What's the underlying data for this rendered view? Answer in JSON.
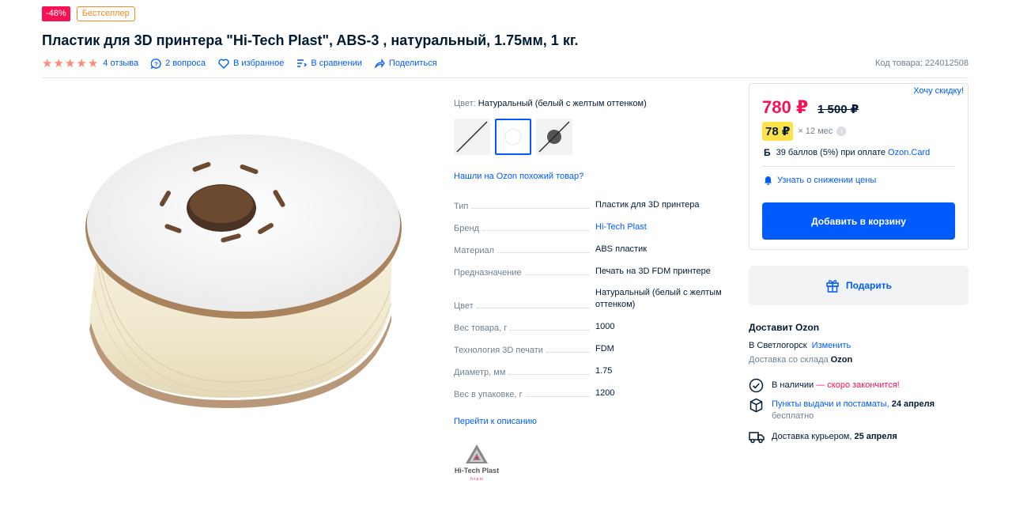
{
  "badges": {
    "sale": "-48%",
    "bestseller": "Бестселлер"
  },
  "product": {
    "title": "Пластик для 3D принтера \"Hi-Tech Plast\", ABS-3 , натуральный, 1.75мм, 1 кг.",
    "rating_stars": 5,
    "reviews": "4 отзыва",
    "questions": "2 вопроса",
    "favorite": "В избранное",
    "compare": "В сравнении",
    "share": "Поделиться",
    "sku": "Код товара: 224012508"
  },
  "variant": {
    "color_label": "Цвет:",
    "color_value": "Натуральный (белый с желтым оттенком)",
    "similar_link": "Нашли на Ozon похожий товар?"
  },
  "specs": [
    {
      "key": "Тип",
      "value": "Пластик для 3D принтера",
      "link": false
    },
    {
      "key": "Бренд",
      "value": "Hi-Tech Plast",
      "link": true
    },
    {
      "key": "Материал",
      "value": "ABS пластик",
      "link": false
    },
    {
      "key": "Предназначение",
      "value": "Печать на 3D FDM принтере",
      "link": false
    },
    {
      "key": "Цвет",
      "value": "Натуральный (белый с желтым оттенком)",
      "link": false
    },
    {
      "key": "Вес товара, г",
      "value": "1000",
      "link": false
    },
    {
      "key": "Технология 3D печати",
      "value": "FDM",
      "link": false
    },
    {
      "key": "Диаметр, мм",
      "value": "1.75",
      "link": false
    },
    {
      "key": "Вес в упаковке, г",
      "value": "1200",
      "link": false
    }
  ],
  "goto_description": "Перейти к описанию",
  "brand_logo": {
    "name": "Hi-Tech Plast",
    "site": "h-t-p.ru"
  },
  "price_card": {
    "want_discount": "Хочу скидку!",
    "price": "780 ₽",
    "old_price": "1 500 ₽",
    "installment_amount": "78 ₽",
    "installment_term": "× 12 мес",
    "bonus_icon": "Б",
    "bonus_text": "39 баллов (5%) при оплате",
    "bonus_link": "Ozon.Card",
    "notify_price": "Узнать о снижении цены",
    "add_to_cart": "Добавить в корзину"
  },
  "gift_button": "Подарить",
  "delivery": {
    "title": "Доставит Ozon",
    "city": "В Светлогорск",
    "change": "Изменить",
    "warehouse_prefix": "Доставка со склада",
    "warehouse_name": "Ozon",
    "in_stock": "В наличии",
    "in_stock_warning": "— скоро закончится!",
    "pickup_link": "Пункты выдачи и постаматы,",
    "pickup_date": "24 апреля",
    "pickup_price": "бесплатно",
    "courier": "Доставка курьером,",
    "courier_date": "25 апреля"
  },
  "colors": {
    "accent": "#005bff",
    "sale": "#f91155",
    "bestseller": "#f08a24",
    "star": "#fc8a75",
    "installment": "#ffe249"
  },
  "icons": [
    "star-icon",
    "question-icon",
    "heart-icon",
    "compare-icon",
    "share-icon",
    "bell-icon",
    "gift-icon",
    "check-circle-icon",
    "box-icon",
    "truck-icon",
    "info-icon"
  ]
}
